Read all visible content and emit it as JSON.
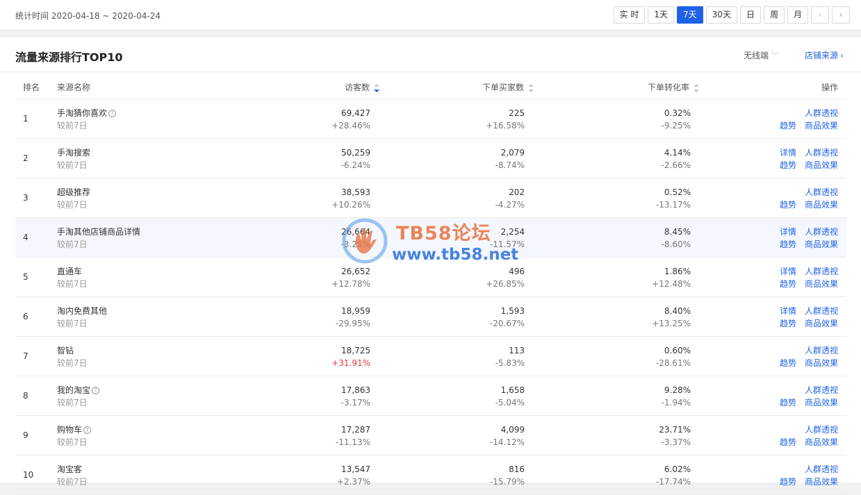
{
  "header": {
    "stat_time": "统计时间 2020-04-18 ~ 2020-04-24",
    "ranges": [
      "实 时",
      "1天",
      "7天",
      "30天",
      "日",
      "周",
      "月"
    ],
    "active_range": "7天",
    "prev_icon": "‹",
    "next_icon": "›"
  },
  "card": {
    "title": "流量来源排行TOP10",
    "device_select": "无线端",
    "shop_source": "店铺来源"
  },
  "table": {
    "columns": {
      "rank": "排名",
      "name": "来源名称",
      "uv": "访客数",
      "buyers": "下单买家数",
      "rate": "下单转化率",
      "ops": "操作"
    },
    "compare_label": "较前7日",
    "rows": [
      {
        "rank": "1",
        "name": "手淘猜你喜欢",
        "help": true,
        "uv": "69,427",
        "uv_d": "+28.46%",
        "buyers": "225",
        "buyers_d": "+16.58%",
        "rate": "0.32%",
        "rate_d": "-9.25%",
        "detail": false
      },
      {
        "rank": "2",
        "name": "手淘搜索",
        "help": false,
        "uv": "50,259",
        "uv_d": "-6.24%",
        "buyers": "2,079",
        "buyers_d": "-8.74%",
        "rate": "4.14%",
        "rate_d": "-2.66%",
        "detail": true
      },
      {
        "rank": "3",
        "name": "超级推荐",
        "help": false,
        "uv": "38,593",
        "uv_d": "+10.26%",
        "buyers": "202",
        "buyers_d": "-4.27%",
        "rate": "0.52%",
        "rate_d": "-13.17%",
        "detail": false
      },
      {
        "rank": "4",
        "name": "手淘其他店铺商品详情",
        "help": false,
        "uv": "26,664",
        "uv_d": "-3.25%",
        "buyers": "2,254",
        "buyers_d": "-11.57%",
        "rate": "8.45%",
        "rate_d": "-8.60%",
        "detail": true
      },
      {
        "rank": "5",
        "name": "直通车",
        "help": false,
        "uv": "26,652",
        "uv_d": "+12.78%",
        "buyers": "496",
        "buyers_d": "+26.85%",
        "rate": "1.86%",
        "rate_d": "+12.48%",
        "detail": true
      },
      {
        "rank": "6",
        "name": "淘内免费其他",
        "help": false,
        "uv": "18,959",
        "uv_d": "-29.95%",
        "buyers": "1,593",
        "buyers_d": "-20.67%",
        "rate": "8.40%",
        "rate_d": "+13.25%",
        "detail": true
      },
      {
        "rank": "7",
        "name": "智钻",
        "help": false,
        "uv": "18,725",
        "uv_d": "+31.91%",
        "uv_up": true,
        "buyers": "113",
        "buyers_d": "-5.83%",
        "rate": "0.60%",
        "rate_d": "-28.61%",
        "detail": false
      },
      {
        "rank": "8",
        "name": "我的淘宝",
        "help": true,
        "uv": "17,863",
        "uv_d": "-3.17%",
        "buyers": "1,658",
        "buyers_d": "-5.04%",
        "rate": "9.28%",
        "rate_d": "-1.94%",
        "detail": false
      },
      {
        "rank": "9",
        "name": "购物车",
        "help": true,
        "uv": "17,287",
        "uv_d": "-11.13%",
        "buyers": "4,099",
        "buyers_d": "-14.12%",
        "rate": "23.71%",
        "rate_d": "-3.37%",
        "detail": false
      },
      {
        "rank": "10",
        "name": "淘宝客",
        "help": false,
        "uv": "13,547",
        "uv_d": "+2.37%",
        "buyers": "816",
        "buyers_d": "-15.79%",
        "rate": "6.02%",
        "rate_d": "-17.74%",
        "detail": false
      }
    ],
    "ops": {
      "detail": "详情",
      "crowd": "人群透视",
      "trend": "趋势",
      "goods": "商品效果"
    }
  },
  "watermark": {
    "title": "TB58论坛",
    "url": "www.tb58.net"
  },
  "colors": {
    "accent": "#2062e6",
    "up": "#e4393c"
  }
}
